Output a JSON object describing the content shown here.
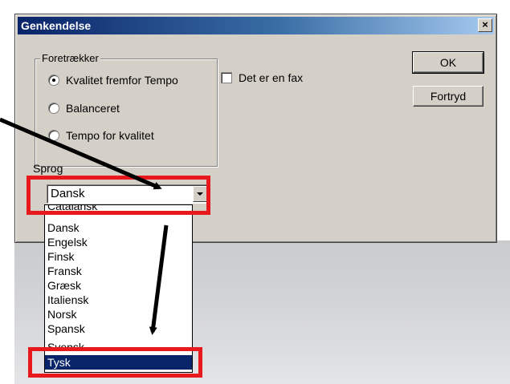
{
  "dialog": {
    "title": "Genkendelse",
    "close_glyph": "×"
  },
  "preferences": {
    "group_label": "Foretrækker",
    "options": [
      {
        "label": "Kvalitet fremfor Tempo",
        "selected": true
      },
      {
        "label": "Balanceret",
        "selected": false
      },
      {
        "label": "Tempo for kvalitet",
        "selected": false
      }
    ]
  },
  "fax_checkbox": {
    "label": "Det er en fax",
    "checked": false
  },
  "buttons": {
    "ok": "OK",
    "cancel": "Fortryd"
  },
  "language": {
    "label": "Sprog",
    "selected_value": "Dansk",
    "list": [
      "Catalansk",
      "Dansk",
      "Engelsk",
      "Finsk",
      "Fransk",
      "Græsk",
      "Italiensk",
      "Norsk",
      "Spansk",
      "Svensk",
      "Tysk"
    ],
    "highlighted_item": "Tysk"
  },
  "icons": {
    "dropdown": "chevron-down-icon",
    "close": "close-icon"
  },
  "colors": {
    "titlebar_start": "#0a246a",
    "titlebar_end": "#a6caf0",
    "selection": "#0a246a",
    "annotation_red": "#e8191c",
    "dialog_face": "#d4d0c8"
  }
}
